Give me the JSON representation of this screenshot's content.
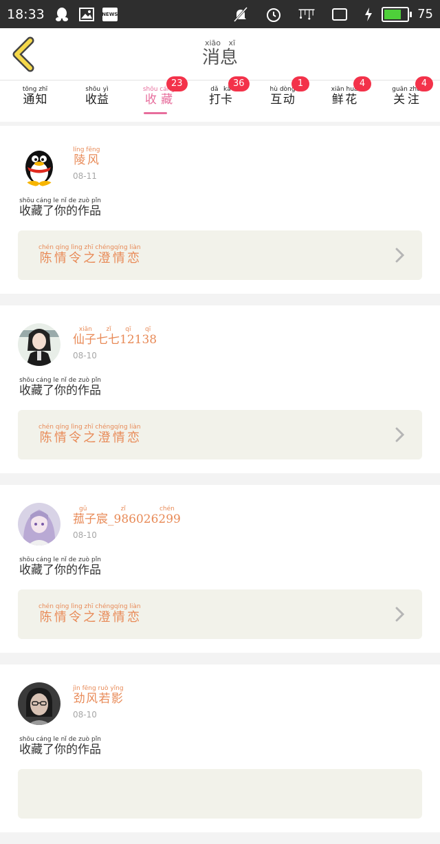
{
  "status_bar": {
    "time": "18:33",
    "battery_level": "75",
    "battery_fraction": 0.75
  },
  "header": {
    "title_pinyin": "xiāo xī",
    "title": "消息"
  },
  "tabs": [
    {
      "pinyin": "tōng zhī",
      "label": "通知",
      "badge": ""
    },
    {
      "pinyin": "shōu yì",
      "label": "收益",
      "badge": ""
    },
    {
      "pinyin": "shōu cáng",
      "label": "收藏",
      "badge": "23"
    },
    {
      "pinyin": "dǎ kǎ",
      "label": "打卡",
      "badge": "36"
    },
    {
      "pinyin": "hù dòng",
      "label": "互动",
      "badge": "1"
    },
    {
      "pinyin": "xiān huā",
      "label": "鲜花",
      "badge": "4"
    },
    {
      "pinyin": "guān zhù",
      "label": "关注",
      "badge": "4"
    }
  ],
  "active_tab": 2,
  "notifications": [
    {
      "user_pinyin": "líng fēng",
      "user": "陵风",
      "date": "08-11",
      "action_pinyin": "shōu cáng le nǐ de zuò pǐn",
      "action": "收藏了你的作品",
      "work_pinyin": "chén qíng lìng zhī chéngqíng liàn",
      "work": "陈情令之澄情恋",
      "avatar": "penguin"
    },
    {
      "user_pinyin": "xiān zǐ qī qī",
      "user": "仙子七七12138",
      "date": "08-10",
      "action_pinyin": "shōu cáng le nǐ de zuò pǐn",
      "action": "收藏了你的作品",
      "work_pinyin": "chén qíng lìng zhī chéngqíng liàn",
      "work": "陈情令之澄情恋",
      "avatar": "anime-boy"
    },
    {
      "user_pinyin": "gū zǐ chén",
      "user": "菰子宸_986026299",
      "date": "08-10",
      "action_pinyin": "shōu cáng le nǐ de zuò pǐn",
      "action": "收藏了你的作品",
      "work_pinyin": "chén qíng lìng zhī chéngqíng liàn",
      "work": "陈情令之澄情恋",
      "avatar": "anime-girl"
    },
    {
      "user_pinyin": "jìn fēng ruò yǐng",
      "user": "劲风若影",
      "date": "08-10",
      "action_pinyin": "shōu cáng le nǐ de zuò pǐn",
      "action": "收藏了你的作品",
      "work_pinyin": "",
      "work": "",
      "avatar": "photo-person"
    }
  ],
  "colors": {
    "accent_pink": "#e76d9c",
    "badge_red": "#f3324a",
    "username_orange": "#e88a57",
    "back_arrow_yellow": "#f5d84a"
  }
}
